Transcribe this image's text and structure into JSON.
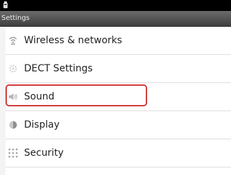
{
  "screen_title": "Settings",
  "settings_list": [
    {
      "label": "Wireless & networks",
      "icon": "wifi-icon"
    },
    {
      "label": "DECT Settings",
      "icon": "gear-icon"
    },
    {
      "label": "Sound",
      "icon": "speaker-icon"
    },
    {
      "label": "Display",
      "icon": "display-icon"
    },
    {
      "label": "Security",
      "icon": "grid-lock-icon"
    }
  ],
  "highlight_color": "#d03a3a"
}
